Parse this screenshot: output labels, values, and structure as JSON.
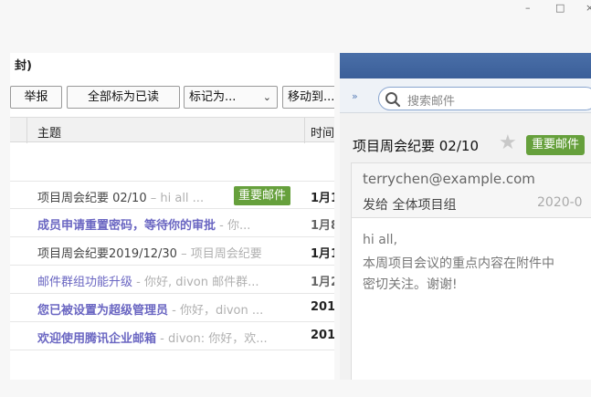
{
  "window": {
    "minimize": "–",
    "maximize": "□",
    "close": "×"
  },
  "list": {
    "folder_title": "封)",
    "toolbar": {
      "report": "举报",
      "mark_all_read": "全部标为已读",
      "mark_as": "标记为...",
      "move_to": "移动到..."
    },
    "columns": {
      "subject": "主题",
      "time": "时间"
    },
    "mails": [
      {
        "subject": "项目周会纪要 02/10",
        "preview": " – hi all ...",
        "tag": "重要邮件",
        "time": "1月1",
        "style": "read-gray"
      },
      {
        "subject": "成员申请重置密码，等待你的审批",
        "preview": " - 你...",
        "tag": "",
        "time": "1月8",
        "style": "unread"
      },
      {
        "subject": "项目周会纪要2019/12/30",
        "preview": " – 项目周会纪要",
        "tag": "",
        "time": "1月1",
        "style": "read-gray"
      },
      {
        "subject": "邮件群组功能升级",
        "preview": " - 你好, divon 邮件群...",
        "tag": "",
        "time": "1月2",
        "style": "read-blue"
      },
      {
        "subject": "您已被设置为超级管理员",
        "preview": " - 你好，divon ...",
        "tag": "",
        "time": "201",
        "style": "unread"
      },
      {
        "subject": "欢迎使用腾讯企业邮箱",
        "preview": " - divon: 你好，欢...",
        "tag": "",
        "time": "201",
        "style": "unread"
      }
    ]
  },
  "reader": {
    "expand": "»",
    "search_placeholder": "搜索邮件",
    "subject": "项目周会纪要 02/10",
    "tag": "重要邮件",
    "from": "terrychen@example.com",
    "to_label": "发给 全体项目组",
    "date": "2020-0",
    "body": [
      "hi all,",
      "本周项目会议的重点内容在附件中",
      "密切关注。谢谢!"
    ]
  },
  "colors": {
    "accent_blue": "#4a6fa8",
    "tag_green": "#66a03c",
    "unread_purple": "#6a66c2"
  }
}
